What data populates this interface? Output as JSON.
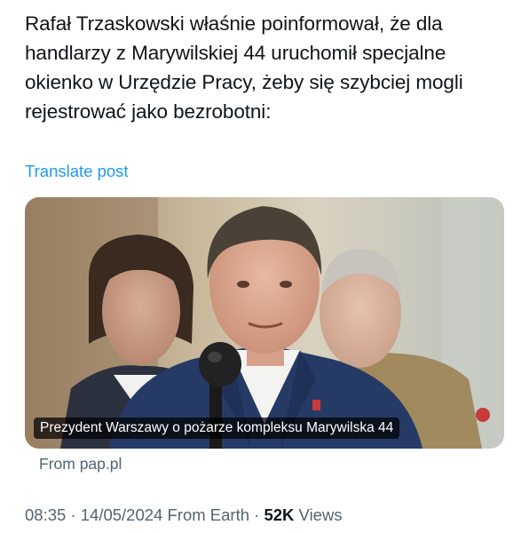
{
  "post": {
    "text": "Rafał Trzaskowski właśnie poinformował, że dla handlarzy z Marywilskiej 44 uruchomił specjalne okienko w Urzędzie Pracy, żeby się szybciej mogli rejestrować jako bezrobotni:",
    "translate_label": "Translate post"
  },
  "card": {
    "caption": "Prezydent Warszawy o pożarze kompleksu Marywilska 44",
    "source": "From pap.pl"
  },
  "meta": {
    "time": "08:35",
    "sep1": " · ",
    "date": "14/05/2024",
    "via": " From Earth",
    "sep2": " · ",
    "views_count": "52K",
    "views_label": " Views"
  },
  "colors": {
    "link": "#1d9bf0",
    "secondary_text": "#536471",
    "primary_text": "#0f1419"
  }
}
